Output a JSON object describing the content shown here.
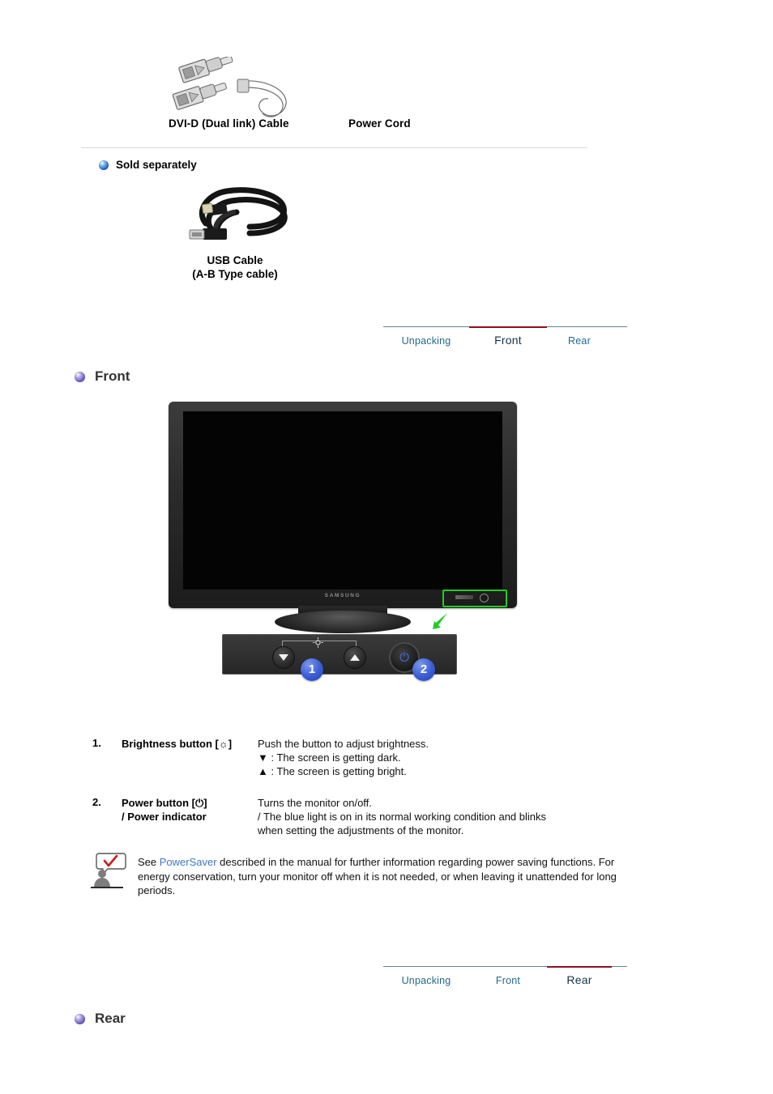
{
  "accessories": {
    "dvi_cable_label": "DVI-D (Dual link) Cable",
    "power_cord_label": "Power Cord",
    "dvi_cable_icon": "dvi-cable-illustration",
    "power_cord_icon": "power-cord-illustration"
  },
  "sold_separately": {
    "heading": "Sold separately",
    "bullet_icon": "blue-sphere-bullet",
    "usb_cable_icon": "usb-cable-illustration",
    "usb_caption_line1": "USB Cable",
    "usb_caption_line2": "(A-B Type cable)"
  },
  "tabs_front": [
    {
      "label": "Unpacking",
      "active": false
    },
    {
      "label": "Front",
      "active": true
    },
    {
      "label": "Rear",
      "active": false
    },
    {
      "label": "",
      "active": false
    }
  ],
  "tabs_rear": [
    {
      "label": "Unpacking",
      "active": false
    },
    {
      "label": "Front",
      "active": false
    },
    {
      "label": "Rear",
      "active": true
    },
    {
      "label": "",
      "active": false
    }
  ],
  "front_section": {
    "heading": "Front",
    "bullet_icon": "purple-sphere-bullet",
    "monitor_brand": "SAMSUNG",
    "highlight_icon": "green-highlight-box",
    "pointer_icon": "green-arrow-icon",
    "panel": {
      "down_button_icon": "triangle-down-icon",
      "brightness_icon": "brightness-sun-icon",
      "up_button_icon": "triangle-up-icon",
      "power_button_icon": "power-symbol-icon",
      "badge_1": "1",
      "badge_2": "2"
    },
    "items": [
      {
        "num": "1.",
        "term": "Brightness button [☼]",
        "def_lines": [
          "Push the button to adjust brightness.",
          "▼ : The screen is getting dark.",
          "▲ : The screen is getting bright."
        ]
      },
      {
        "num": "2.",
        "term_line1": "Power button [⏻]",
        "term_line2": "/ Power indicator",
        "def_lines": [
          "Turns the monitor on/off.",
          "/ The blue light is on in its normal working condition and blinks",
          "when setting the adjustments of the monitor."
        ]
      }
    ],
    "note": {
      "icon": "note-person-checkmark-icon",
      "text_before_link": "See ",
      "link_text": "PowerSaver",
      "text_after_link": " described in the manual for further information regarding power saving functions. For energy conservation, turn your monitor off when it is not needed, or when leaving it unattended for long periods."
    }
  },
  "rear_section": {
    "heading": "Rear",
    "bullet_icon": "purple-sphere-bullet"
  },
  "colors": {
    "active_tab_bar": "#8d101f",
    "active_tab_text": "#16334d",
    "inactive_tab_text": "#1f6a8c",
    "link_blue": "#3f76c8",
    "highlight_green": "#23cc23",
    "badge_blue": "#3c5fd6",
    "power_led_blue": "#3f6fe0",
    "divider_grey": "#d9d9d9"
  }
}
